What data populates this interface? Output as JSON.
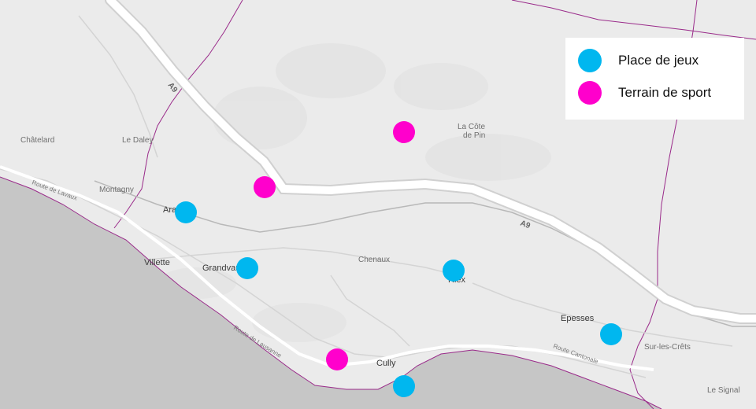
{
  "colors": {
    "playground": "#00B7EF",
    "sport": "#FF00CC",
    "land": "#ebebeb",
    "water": "#c6c6c6",
    "boundary": "#9a2b8a",
    "highway": "#ffffff"
  },
  "legend": {
    "items": [
      {
        "label": "Place de jeux",
        "color": "#00B7EF",
        "kind": "playground"
      },
      {
        "label": "Terrain de sport",
        "color": "#FF00CC",
        "kind": "sport"
      }
    ]
  },
  "places": [
    {
      "id": "chatelard",
      "text": "Châtelard",
      "kind": "place"
    },
    {
      "id": "le-daley",
      "text": "Le Daley",
      "kind": "place"
    },
    {
      "id": "montagny",
      "text": "Montagny",
      "kind": "place"
    },
    {
      "id": "la-cote-de-pin-1",
      "text": "La Côte",
      "kind": "place"
    },
    {
      "id": "la-cote-de-pin-2",
      "text": "de Pin",
      "kind": "place"
    },
    {
      "id": "chenaux",
      "text": "Chenaux",
      "kind": "place"
    },
    {
      "id": "sur-les-crets",
      "text": "Sur-les-Crêts",
      "kind": "place"
    },
    {
      "id": "le-signal",
      "text": "Le Signal",
      "kind": "place"
    },
    {
      "id": "aran",
      "text": "Aran",
      "kind": "town"
    },
    {
      "id": "villette",
      "text": "Villette",
      "kind": "town"
    },
    {
      "id": "grandvaux",
      "text": "Grandvaux",
      "kind": "town"
    },
    {
      "id": "riex",
      "text": "Riex",
      "kind": "town"
    },
    {
      "id": "epesses",
      "text": "Epesses",
      "kind": "town"
    },
    {
      "id": "cully",
      "text": "Cully",
      "kind": "town"
    }
  ],
  "roads": [
    {
      "id": "route-de-lavaux",
      "text": "Route de Lavaux"
    },
    {
      "id": "route-de-lausanne",
      "text": "Route de Lausanne"
    },
    {
      "id": "route-cantonale",
      "text": "Route Cantonale"
    },
    {
      "id": "a9-north",
      "text": "A9"
    },
    {
      "id": "a9-east",
      "text": "A9"
    }
  ],
  "markers": [
    {
      "id": "sport-cote-de-pin",
      "kind": "sport",
      "near": "La Côte de Pin"
    },
    {
      "id": "sport-a9",
      "kind": "sport",
      "near": "A9"
    },
    {
      "id": "sport-cully-west",
      "kind": "sport",
      "near": "Cully"
    },
    {
      "id": "play-aran",
      "kind": "playground",
      "near": "Aran"
    },
    {
      "id": "play-grandvaux",
      "kind": "playground",
      "near": "Grandvaux"
    },
    {
      "id": "play-riex",
      "kind": "playground",
      "near": "Riex"
    },
    {
      "id": "play-epesses",
      "kind": "playground",
      "near": "Epesses"
    },
    {
      "id": "play-cully",
      "kind": "playground",
      "near": "Cully"
    }
  ]
}
